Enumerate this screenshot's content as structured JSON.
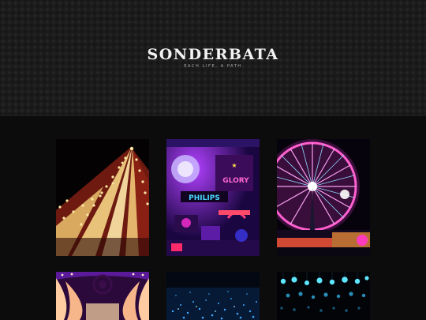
{
  "site": {
    "title": "SONDERBATA",
    "tagline": "EACH LIFE, A PATH"
  },
  "posts": [
    {
      "subject": "circus-tent-lights-photo"
    },
    {
      "subject": "neon-signs-photo",
      "signs": [
        "PHILIPS",
        "GLORY"
      ]
    },
    {
      "subject": "ferris-wheel-photo"
    },
    {
      "subject": "lit-curtain-arch-photo"
    },
    {
      "subject": "blue-light-field-photo"
    },
    {
      "subject": "hanging-blue-orbs-photo"
    }
  ]
}
